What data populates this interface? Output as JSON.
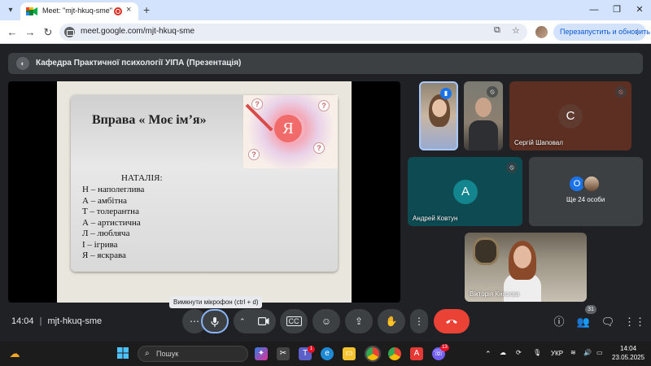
{
  "browser": {
    "tab_title": "Meet: \"mjt-hkuq-sme\"",
    "tab_close": "×",
    "new_tab": "+",
    "url": "meet.google.com/mjt-hkuq-sme",
    "relaunch_label": "Перезапустить и обновить",
    "window_controls": {
      "minimize": "—",
      "maximize": "❐",
      "close": "✕"
    }
  },
  "meet": {
    "presentation_title": "Кафедра Практичної психології УІПА (Презентація)",
    "slide": {
      "title": "Вправа « Моє ім’я»",
      "art_letter": "Я",
      "name": "НАТАЛІЯ:",
      "acrostic": [
        "Н – наполеглива",
        "А – амбітна",
        "Т – толерантна",
        "А – артистична",
        "Л – любляча",
        "І – ігрива",
        "Я – яскрава"
      ]
    },
    "participants": {
      "serhii": {
        "name": "Сергій Шаповал",
        "initial": "С"
      },
      "andrii": {
        "name": "Андрей Ковтун",
        "initial": "А"
      },
      "others": {
        "label": "Ще 24 особи",
        "initial": "О"
      },
      "viktoriia": {
        "name": "Вікторія Князєва"
      }
    },
    "tooltip": "Вимкнути мікрофон (ctrl + d)",
    "time": "14:04",
    "separator": "|",
    "meeting_code": "mjt-hkuq-sme",
    "people_count": "31"
  },
  "taskbar": {
    "search_label": "Пошук",
    "language": "УКР",
    "time": "14:04",
    "date": "23.05.2025",
    "teams_badge": "1",
    "viber_badge": "13"
  },
  "colors": {
    "accent_blue": "#8ab4f8",
    "end_call_red": "#ea4335",
    "tile_teal": "#0d4a52",
    "tile_brown": "#5c2f22"
  }
}
